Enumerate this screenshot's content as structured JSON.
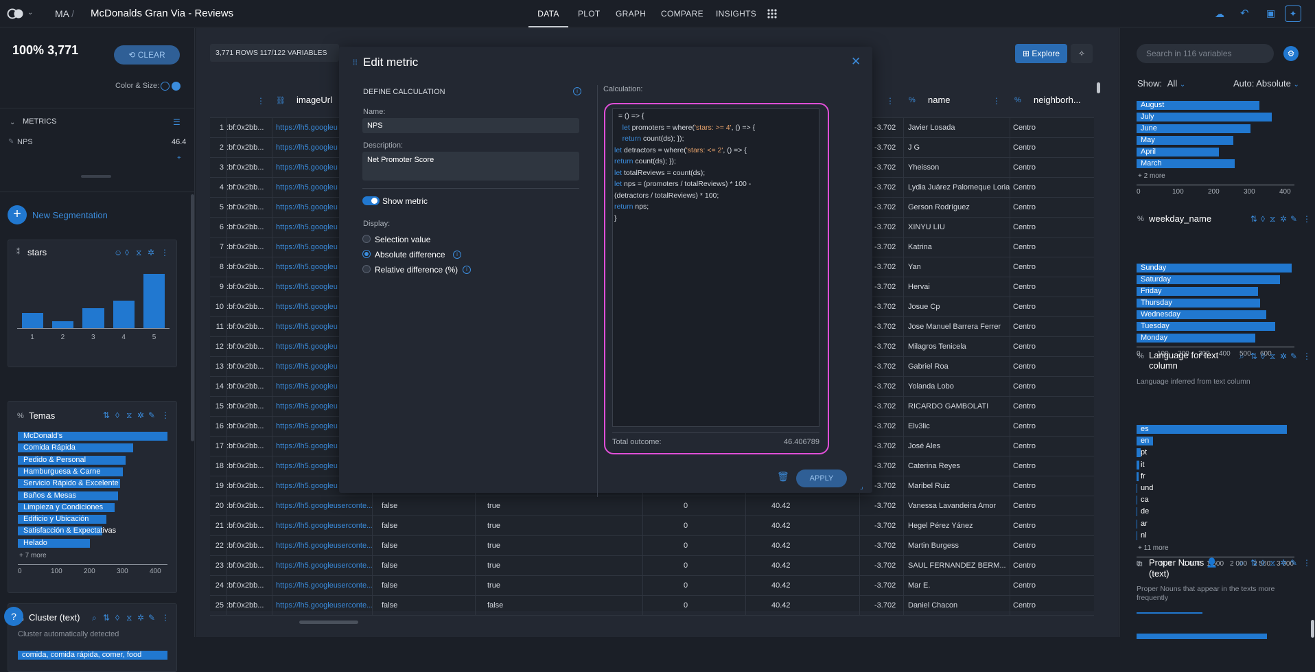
{
  "app": {
    "breadcrumb": "MA",
    "title": "McDonalds Gran Via - Reviews"
  },
  "nav": [
    "DATA",
    "PLOT",
    "GRAPH",
    "COMPARE",
    "INSIGHTS"
  ],
  "left": {
    "percent": "100%",
    "count": "3,771",
    "clear": "CLEAR",
    "color_size": "Color & Size:",
    "metrics_title": "METRICS",
    "metric_name": "NPS",
    "metric_value": "46.4",
    "new_seg": "New Segmentation",
    "stars": {
      "title": "stars",
      "values": [
        0.24,
        0.11,
        0.31,
        0.43,
        0.86
      ],
      "ticks": [
        "1",
        "2",
        "3",
        "4",
        "5"
      ]
    },
    "temas": {
      "title": "Temas",
      "labels": [
        "McDonald's",
        "Comida Rápida",
        "Pedido & Personal",
        "Hamburguesa & Carne",
        "Servicio Rápido & Excelente",
        "Baños & Mesas",
        "Limpieza y Condiciones",
        "Edificio y Ubicación",
        "Satisfacción & Expectativas",
        "Helado"
      ],
      "values": [
        440,
        340,
        316,
        308,
        300,
        294,
        284,
        260,
        248,
        212
      ],
      "more": "+ 7 more",
      "ticks": [
        "0",
        "100",
        "200",
        "300",
        "400"
      ]
    },
    "cluster": {
      "title": "Cluster (text)",
      "subtitle": "Cluster automatically detected",
      "first": "comida, comida rápida, comer, food"
    }
  },
  "grid": {
    "rows_info": "3,771 ROWS 117/122 VARIABLES",
    "explore": "Explore",
    "col_image": "imageUrl",
    "col_name": "name",
    "col_neigh": "neighborh...",
    "prefix": ":bf:0x2bb...",
    "url": "https://lh5.googleu",
    "url_long": "https://lh5.googleuserconte...",
    "lng": "-3.702",
    "centro": "Centro",
    "names": [
      "Javier Losada",
      "J G",
      "Yheisson",
      "Lydia Juárez Palomeque Loria",
      "Gerson Rodríguez",
      "XINYU LIU",
      "Katrina",
      "Yan",
      "Hervai",
      "Josue Cp",
      "Jose Manuel Barrera Ferrer",
      "Milagros Tenicela",
      "Gabriel Roa",
      "Yolanda Lobo",
      "RICARDO GAMBOLATI",
      "Elv3lic",
      "José Ales",
      "Caterina Reyes",
      "Maribel Ruiz",
      "Vanessa Lavandeira Amor",
      "Hegel Pérez Yánez",
      "Martin Burgess",
      "SAUL FERNANDEZ BERM...",
      "Mar E.",
      "Daniel Chacon"
    ],
    "extra": [
      [
        "false",
        "true",
        "0",
        "40.42"
      ],
      [
        "false",
        "true",
        "0",
        "40.42"
      ],
      [
        "false",
        "true",
        "0",
        "40.42"
      ],
      [
        "false",
        "true",
        "0",
        "40.42"
      ],
      [
        "false",
        "true",
        "0",
        "40.42"
      ],
      [
        "false",
        "false",
        "0",
        "40.42"
      ]
    ]
  },
  "modal": {
    "title": "Edit metric",
    "define": "DEFINE CALCULATION",
    "name_label": "Name:",
    "name_value": "NPS",
    "desc_label": "Description:",
    "desc_value": "Net Promoter Score",
    "show_metric": "Show metric",
    "display_label": "Display:",
    "opt1": "Selection value",
    "opt2": "Absolute difference",
    "opt3": "Relative difference (%)",
    "calc_label": "Calculation:",
    "total_label": "Total outcome:",
    "total_value": "46.406789",
    "apply": "APPLY"
  },
  "right": {
    "search_placeholder": "Search in 116 variables",
    "show": "Show:",
    "show_val": "All",
    "auto": "Auto: Absolute",
    "months": {
      "labels": [
        "August",
        "July",
        "June",
        "May",
        "April",
        "March"
      ],
      "values": [
        350,
        385,
        325,
        275,
        235,
        280
      ],
      "more": "+ 2 more",
      "ticks": [
        "0",
        "100",
        "200",
        "300",
        "400"
      ]
    },
    "weekday": {
      "title": "weekday_name",
      "labels": [
        "Sunday",
        "Saturday",
        "Friday",
        "Thursday",
        "Wednesday",
        "Tuesday",
        "Monday"
      ],
      "values": [
        640,
        590,
        500,
        510,
        535,
        570,
        490
      ],
      "ticks": [
        "0",
        "100",
        "200",
        "300",
        "400",
        "500",
        "600"
      ]
    },
    "lang": {
      "title": "Language for text column",
      "subtitle": "Language inferred from text column",
      "labels": [
        "es",
        "en",
        "pt",
        "it",
        "fr",
        "und",
        "ca",
        "de",
        "ar",
        "nl"
      ],
      "values": [
        2950,
        330,
        80,
        60,
        40,
        20,
        12,
        10,
        8,
        6
      ],
      "more": "+ 11 more",
      "ticks": [
        "0",
        "500",
        "1 000",
        "1 500",
        "2 000",
        "2 500",
        "3 000"
      ]
    },
    "proper": {
      "title": "Proper Nouns 👤 (text)",
      "subtitle": "Proper Nouns that appear in the texts more frequently"
    }
  }
}
